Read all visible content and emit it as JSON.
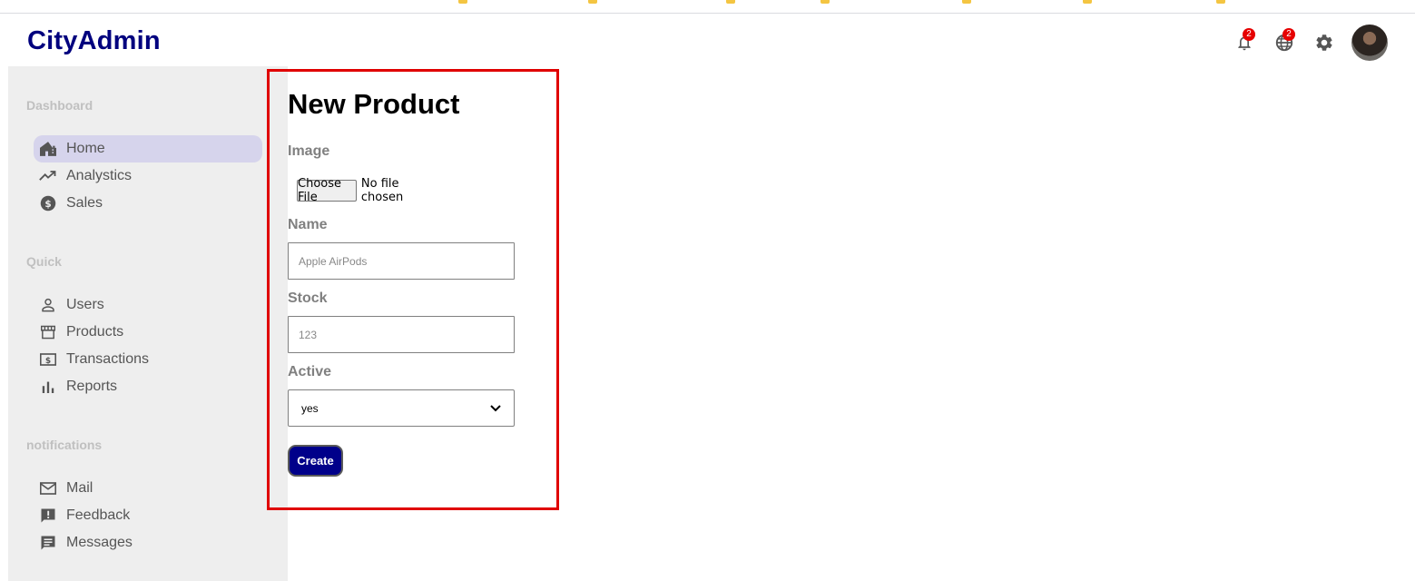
{
  "app": {
    "title": "CityAdmin"
  },
  "topbar": {
    "notifications_badge": "2",
    "language_badge": "2",
    "icons": [
      "bell-icon",
      "globe-icon",
      "gear-icon",
      "avatar"
    ]
  },
  "sidebar": {
    "sections": [
      {
        "title": "Dashboard",
        "items": [
          {
            "label": "Home",
            "icon": "home-icon",
            "active": true
          },
          {
            "label": "Analystics",
            "icon": "trending-up-icon"
          },
          {
            "label": "Sales",
            "icon": "dollar-icon"
          }
        ]
      },
      {
        "title": "Quick",
        "items": [
          {
            "label": "Users",
            "icon": "user-icon"
          },
          {
            "label": "Products",
            "icon": "storefront-icon"
          },
          {
            "label": "Transactions",
            "icon": "money-icon"
          },
          {
            "label": "Reports",
            "icon": "bar-chart-icon"
          }
        ]
      },
      {
        "title": "notifications",
        "items": [
          {
            "label": "Mail",
            "icon": "mail-icon"
          },
          {
            "label": "Feedback",
            "icon": "feedback-icon"
          },
          {
            "label": "Messages",
            "icon": "chat-icon"
          }
        ]
      }
    ]
  },
  "form": {
    "title": "New Product",
    "image_label": "Image",
    "choose_file_label": "Choose File",
    "no_file_text": "No file chosen",
    "name_label": "Name",
    "name_placeholder": "Apple AirPods",
    "stock_label": "Stock",
    "stock_placeholder": "123",
    "active_label": "Active",
    "active_value": "yes",
    "create_label": "Create"
  },
  "colors": {
    "brand": "#00007e",
    "button": "#00008a",
    "badge": "#e60000",
    "active_nav": "#d6d4ec",
    "sidebar_bg": "#eeeeee",
    "highlight": "#e00000"
  }
}
